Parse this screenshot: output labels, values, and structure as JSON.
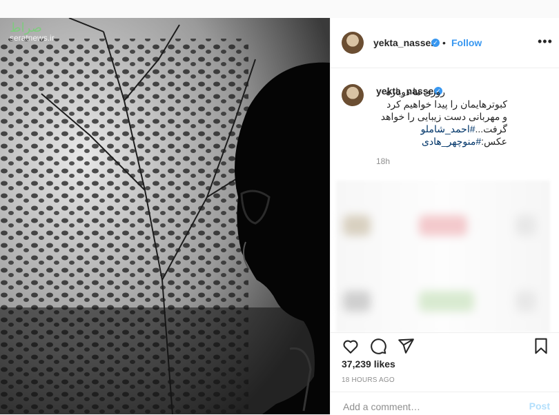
{
  "watermark": {
    "logo": "صراط",
    "site": "seratnews.ir"
  },
  "post": {
    "username": "yekta_nasser",
    "verified_icon": "verified-badge-icon",
    "separator": "•",
    "follow_label": "Follow",
    "more_icon": "ellipsis-icon",
    "more_label": "•••",
    "caption": {
      "line1": "روزی ما دوباره",
      "line2": "کبوترهایمان را پیدا خواهیم کرد",
      "line3": "و مهربانی دست زیبایی را خواهد",
      "line4_text": "گرفت...",
      "line4_hash": "#احمد_شاملو",
      "line5_text": "عکس:",
      "line5_hash": "#منوچهر_هادی"
    },
    "caption_age": "18h",
    "likes": "37,239 likes",
    "posted_ago": "18 HOURS AGO",
    "comment_placeholder": "Add a comment…",
    "post_label": "Post"
  },
  "colors": {
    "accent": "#3897f0",
    "hashtag": "#003569",
    "muted": "#8e8e8e"
  },
  "icons": [
    "heart-icon",
    "comment-icon",
    "share-icon",
    "bookmark-icon"
  ]
}
